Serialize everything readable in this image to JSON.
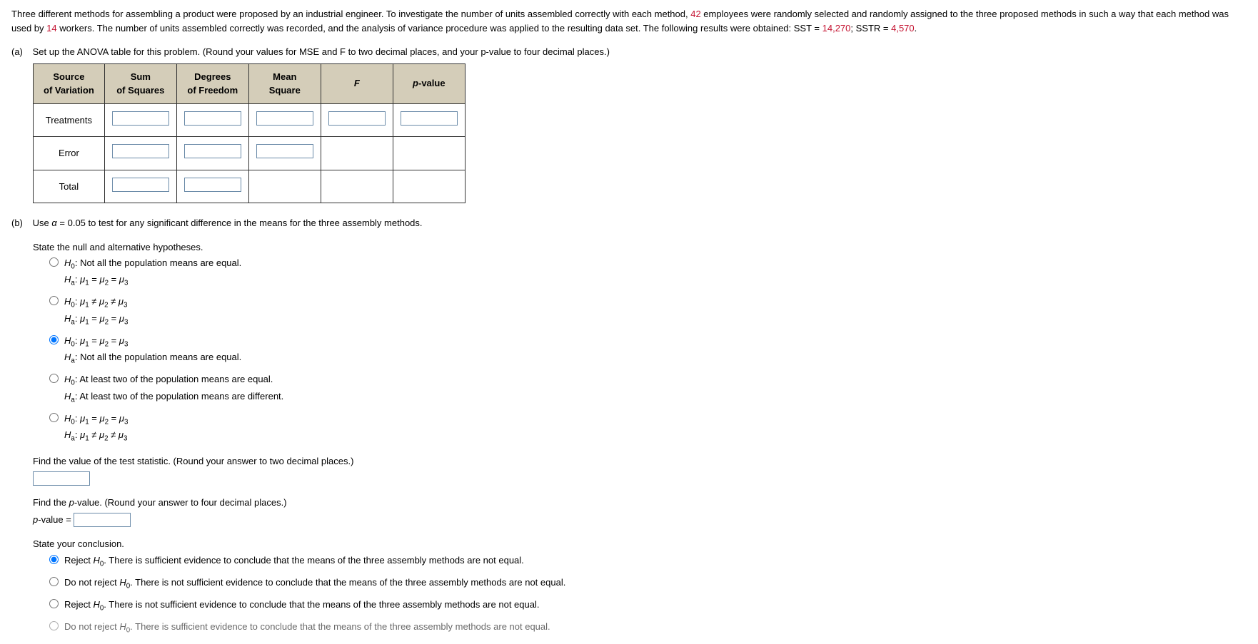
{
  "intro": {
    "p1a": "Three different methods for assembling a product were proposed by an industrial engineer. To investigate the number of units assembled correctly with each method, ",
    "n_emp": "42",
    "p1b": " employees were randomly selected and randomly assigned to the three proposed methods in such a way that each method was used by ",
    "n_workers": "14",
    "p1c": " workers. The number of units assembled correctly was recorded, and the analysis of variance procedure was applied to the resulting data set. The following results were obtained: SST = ",
    "sst": "14,270",
    "p1d": "; SSTR = ",
    "sstr": "4,570",
    "p1e": "."
  },
  "partA": {
    "label": "(a)",
    "text": "Set up the ANOVA table for this problem. (Round your values for MSE and F to two decimal places, and your p-value to four decimal places.)",
    "headers": [
      "Source\nof Variation",
      "Sum\nof Squares",
      "Degrees\nof Freedom",
      "Mean\nSquare",
      "F",
      "p-value"
    ],
    "rows": [
      "Treatments",
      "Error",
      "Total"
    ]
  },
  "partB": {
    "label": "(b)",
    "text": "Use α = 0.05 to test for any significant difference in the means for the three assembly methods.",
    "hyp_heading": "State the null and alternative hypotheses.",
    "options": [
      {
        "h0": "Not all the population means are equal.",
        "ha": "μ₁ = μ₂ = μ₃",
        "h0plain": true,
        "haplain": false
      },
      {
        "h0": "μ₁ ≠ μ₂ ≠ μ₃",
        "ha": "μ₁ = μ₂ = μ₃",
        "h0plain": false,
        "haplain": false
      },
      {
        "h0": "μ₁ = μ₂ = μ₃",
        "ha": "Not all the population means are equal.",
        "h0plain": false,
        "haplain": true,
        "selected": true
      },
      {
        "h0": "At least two of the population means are equal.",
        "ha": "At least two of the population means are different.",
        "h0plain": true,
        "haplain": true
      },
      {
        "h0": "μ₁ = μ₂ = μ₃",
        "ha": "μ₁ ≠ μ₂ ≠ μ₃",
        "h0plain": false,
        "haplain": false
      }
    ],
    "find_stat": "Find the value of the test statistic. (Round your answer to two decimal places.)",
    "find_p": "Find the p-value. (Round your answer to four decimal places.)",
    "p_label": "p-value =",
    "conclusion_heading": "State your conclusion.",
    "conclusions": [
      {
        "text": "Reject H₀. There is sufficient evidence to conclude that the means of the three assembly methods are not equal.",
        "selected": true
      },
      {
        "text": "Do not reject H₀. There is not sufficient evidence to conclude that the means of the three assembly methods are not equal."
      },
      {
        "text": "Reject H₀. There is not sufficient evidence to conclude that the means of the three assembly methods are not equal."
      },
      {
        "text": "Do not reject H₀. There is sufficient evidence to conclude that the means of the three assembly methods are not equal."
      }
    ]
  }
}
